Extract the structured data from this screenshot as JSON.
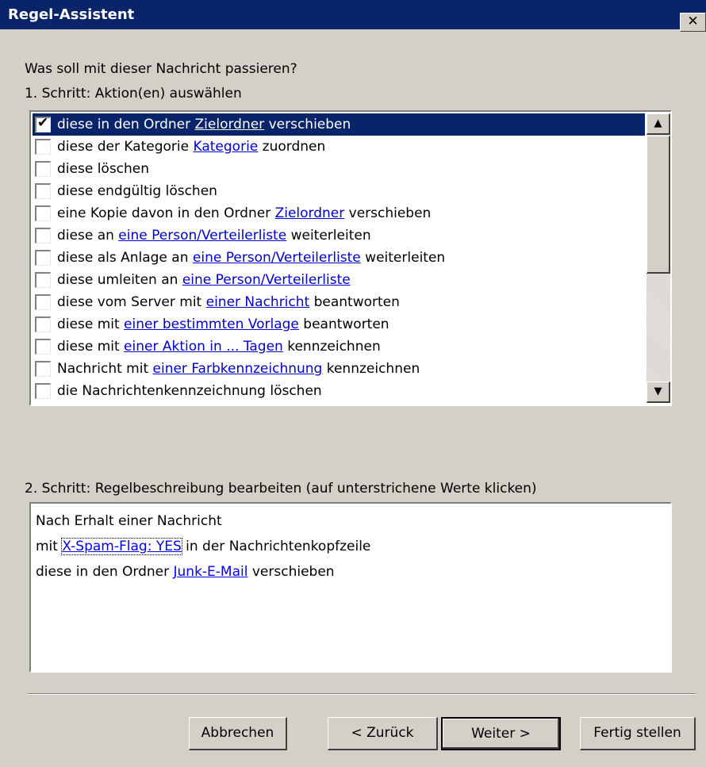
{
  "window": {
    "title": "Regel-Assistent",
    "close_glyph": "✕"
  },
  "prompt": "Was soll mit dieser Nachricht passieren?",
  "step1_label": "1. Schritt: Aktion(en) auswählen",
  "actions": [
    {
      "checked": true,
      "selected": true,
      "parts": [
        {
          "t": "diese in den Ordner "
        },
        {
          "t": "Zielordner",
          "link": true
        },
        {
          "t": " verschieben"
        }
      ]
    },
    {
      "checked": false,
      "parts": [
        {
          "t": "diese der Kategorie "
        },
        {
          "t": "Kategorie",
          "link": true
        },
        {
          "t": " zuordnen"
        }
      ]
    },
    {
      "checked": false,
      "parts": [
        {
          "t": "diese löschen"
        }
      ]
    },
    {
      "checked": false,
      "parts": [
        {
          "t": "diese endgültig löschen"
        }
      ]
    },
    {
      "checked": false,
      "parts": [
        {
          "t": "eine Kopie davon in den Ordner "
        },
        {
          "t": "Zielordner",
          "link": true
        },
        {
          "t": " verschieben"
        }
      ]
    },
    {
      "checked": false,
      "parts": [
        {
          "t": "diese an "
        },
        {
          "t": "eine Person/Verteilerliste",
          "link": true
        },
        {
          "t": " weiterleiten"
        }
      ]
    },
    {
      "checked": false,
      "parts": [
        {
          "t": "diese als Anlage an "
        },
        {
          "t": "eine Person/Verteilerliste",
          "link": true
        },
        {
          "t": " weiterleiten"
        }
      ]
    },
    {
      "checked": false,
      "parts": [
        {
          "t": "diese umleiten an "
        },
        {
          "t": "eine Person/Verteilerliste",
          "link": true
        }
      ]
    },
    {
      "checked": false,
      "parts": [
        {
          "t": "diese vom Server mit "
        },
        {
          "t": "einer Nachricht",
          "link": true
        },
        {
          "t": " beantworten"
        }
      ]
    },
    {
      "checked": false,
      "parts": [
        {
          "t": "diese mit "
        },
        {
          "t": "einer bestimmten Vorlage",
          "link": true
        },
        {
          "t": " beantworten"
        }
      ]
    },
    {
      "checked": false,
      "parts": [
        {
          "t": "diese mit "
        },
        {
          "t": "einer Aktion in ... Tagen",
          "link": true
        },
        {
          "t": " kennzeichnen"
        }
      ]
    },
    {
      "checked": false,
      "parts": [
        {
          "t": "Nachricht mit "
        },
        {
          "t": "einer Farbkennzeichnung",
          "link": true
        },
        {
          "t": " kennzeichnen"
        }
      ]
    },
    {
      "checked": false,
      "parts": [
        {
          "t": "die Nachrichtenkennzeichnung löschen"
        }
      ]
    }
  ],
  "scrollbar": {
    "up_glyph": "▲",
    "down_glyph": "▼"
  },
  "step2_label": "2. Schritt: Regelbeschreibung bearbeiten (auf unterstrichene Werte klicken)",
  "description": {
    "line1": "Nach Erhalt einer Nachricht",
    "line2_pre": "mit ",
    "line2_link": "X-Spam-Flag: YES",
    "line2_post": " in der Nachrichtenkopfzeile",
    "line3_pre": "diese in den Ordner ",
    "line3_link": "Junk-E-Mail",
    "line3_post": " verschieben"
  },
  "buttons": {
    "cancel": "Abbrechen",
    "back": "< Zurück",
    "next": "Weiter >",
    "finish": "Fertig stellen"
  }
}
